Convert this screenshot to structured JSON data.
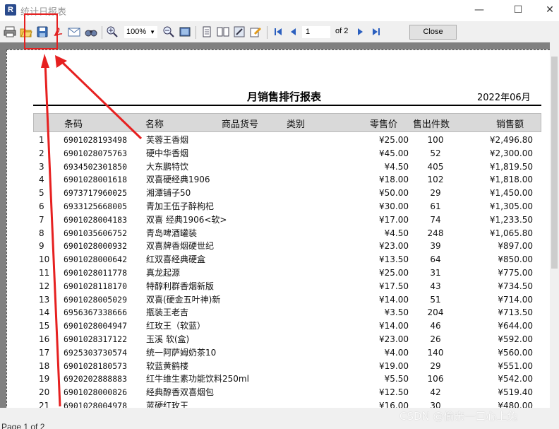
{
  "window": {
    "title": "统计日报表",
    "minimize": "—",
    "maximize": "☐",
    "close": "✕"
  },
  "toolbar": {
    "zoom": "100%",
    "page_current": "1",
    "page_of": "of 2",
    "close_label": "Close"
  },
  "report": {
    "title": "月销售排行报表",
    "date": "2022年06月",
    "headers": {
      "code": "条码",
      "name": "名称",
      "sku": "商品货号",
      "category": "类别",
      "price": "零售价",
      "qty": "售出件数",
      "amount": "销售额"
    },
    "rows": [
      {
        "idx": "1",
        "code": "6901028193498",
        "name": "芙蓉王香烟",
        "price": "¥25.00",
        "qty": "100",
        "amount": "¥2,496.80"
      },
      {
        "idx": "2",
        "code": "6901028075763",
        "name": "硬中华香烟",
        "price": "¥45.00",
        "qty": "52",
        "amount": "¥2,300.00"
      },
      {
        "idx": "3",
        "code": "6934502301850",
        "name": "大东鹏特饮",
        "price": "¥4.50",
        "qty": "405",
        "amount": "¥1,819.50"
      },
      {
        "idx": "4",
        "code": "6901028001618",
        "name": "双喜硬经典1906",
        "price": "¥18.00",
        "qty": "102",
        "amount": "¥1,818.00"
      },
      {
        "idx": "5",
        "code": "6973717960025",
        "name": "湘潭铺子50",
        "price": "¥50.00",
        "qty": "29",
        "amount": "¥1,450.00"
      },
      {
        "idx": "6",
        "code": "6933125668005",
        "name": "青加王伍子醉枸杞",
        "price": "¥30.00",
        "qty": "61",
        "amount": "¥1,305.00"
      },
      {
        "idx": "7",
        "code": "6901028004183",
        "name": "双喜 经典1906<软>",
        "price": "¥17.00",
        "qty": "74",
        "amount": "¥1,233.50"
      },
      {
        "idx": "8",
        "code": "6901035606752",
        "name": "青岛啤酒罐装",
        "price": "¥4.50",
        "qty": "248",
        "amount": "¥1,065.80"
      },
      {
        "idx": "9",
        "code": "6901028000932",
        "name": "双喜牌香烟硬世纪",
        "price": "¥23.00",
        "qty": "39",
        "amount": "¥897.00"
      },
      {
        "idx": "10",
        "code": "6901028000642",
        "name": "红双喜经典硬盒",
        "price": "¥13.50",
        "qty": "64",
        "amount": "¥850.00"
      },
      {
        "idx": "11",
        "code": "6901028011778",
        "name": "真龙起源",
        "price": "¥25.00",
        "qty": "31",
        "amount": "¥775.00"
      },
      {
        "idx": "12",
        "code": "6901028118170",
        "name": "特醇利群香烟新版",
        "price": "¥17.50",
        "qty": "43",
        "amount": "¥734.50"
      },
      {
        "idx": "13",
        "code": "6901028005029",
        "name": "双喜(硬金五叶神)新",
        "price": "¥14.00",
        "qty": "51",
        "amount": "¥714.00"
      },
      {
        "idx": "14",
        "code": "6956367338666",
        "name": "瓶装王老吉",
        "price": "¥3.50",
        "qty": "204",
        "amount": "¥713.50"
      },
      {
        "idx": "15",
        "code": "6901028004947",
        "name": "红玫王（软蓝）",
        "price": "¥14.00",
        "qty": "46",
        "amount": "¥644.00"
      },
      {
        "idx": "16",
        "code": "6901028317122",
        "name": "玉溪 软(盒)",
        "price": "¥23.00",
        "qty": "26",
        "amount": "¥592.00"
      },
      {
        "idx": "17",
        "code": "6925303730574",
        "name": "统一阿萨姆奶茶10",
        "price": "¥4.00",
        "qty": "140",
        "amount": "¥560.00"
      },
      {
        "idx": "18",
        "code": "6901028180573",
        "name": "软蓝黄鹤楼",
        "price": "¥19.00",
        "qty": "29",
        "amount": "¥551.00"
      },
      {
        "idx": "19",
        "code": "6920202888883",
        "name": "红牛维生素功能饮料250ml",
        "price": "¥5.50",
        "qty": "106",
        "amount": "¥542.00"
      },
      {
        "idx": "20",
        "code": "6901028000826",
        "name": "经典醇香双喜烟包",
        "price": "¥12.50",
        "qty": "42",
        "amount": "¥519.40"
      },
      {
        "idx": "21",
        "code": "6901028004978",
        "name": "蓝硬红玫王",
        "price": "¥16.00",
        "qty": "30",
        "amount": "¥480.00"
      }
    ]
  },
  "status": {
    "page_text": "Page 1 of 2"
  },
  "watermark": "CSDN @偷亲一口心上兔",
  "colors": {
    "annotation": "#e62020",
    "viewer_bg": "#808080",
    "header_bg": "#d9d9d9"
  }
}
